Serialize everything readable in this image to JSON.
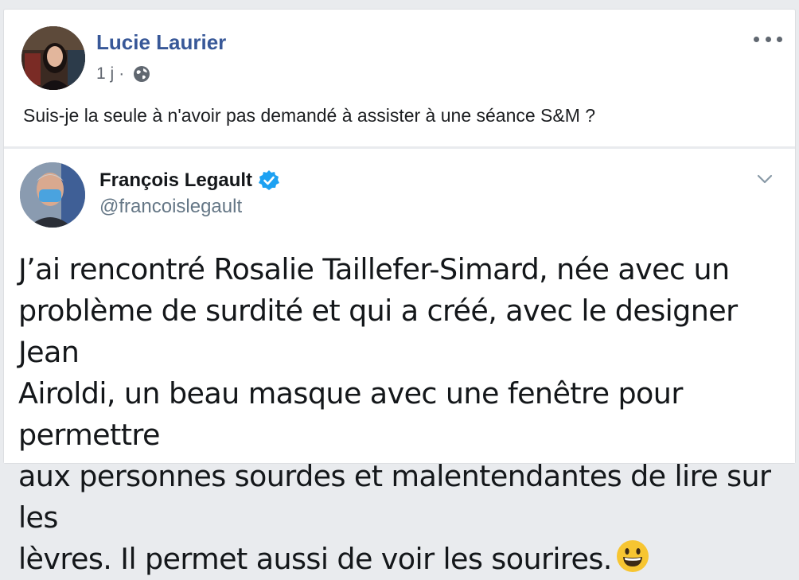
{
  "post": {
    "author": "Lucie Laurier",
    "time": "1 j",
    "separator": "·",
    "audience_icon": "globe-icon",
    "menu_icon": "more-horizontal-icon",
    "text": "Suis-je la seule à n'avoir pas demandé à assister à une séance S&M ?"
  },
  "tweet": {
    "name": "François Legault",
    "verified_icon": "verified-badge-icon",
    "handle": "@francoislegault",
    "menu_icon": "chevron-down-icon",
    "lines": [
      "J’ai rencontré Rosalie Taillefer-Simard, née avec un",
      "problème de surdité et qui a créé, avec le designer Jean",
      "Airoldi, un beau masque avec une fenêtre pour permettre",
      "aux personnes sourdes et malentendantes de lire sur les",
      "lèvres. Il permet aussi de voir les sourires."
    ],
    "emoji": "smiling-face-emoji"
  },
  "colors": {
    "author_link": "#385898",
    "meta_text": "#616770",
    "verified": "#1da1f2",
    "page_background": "#e9ebee"
  }
}
